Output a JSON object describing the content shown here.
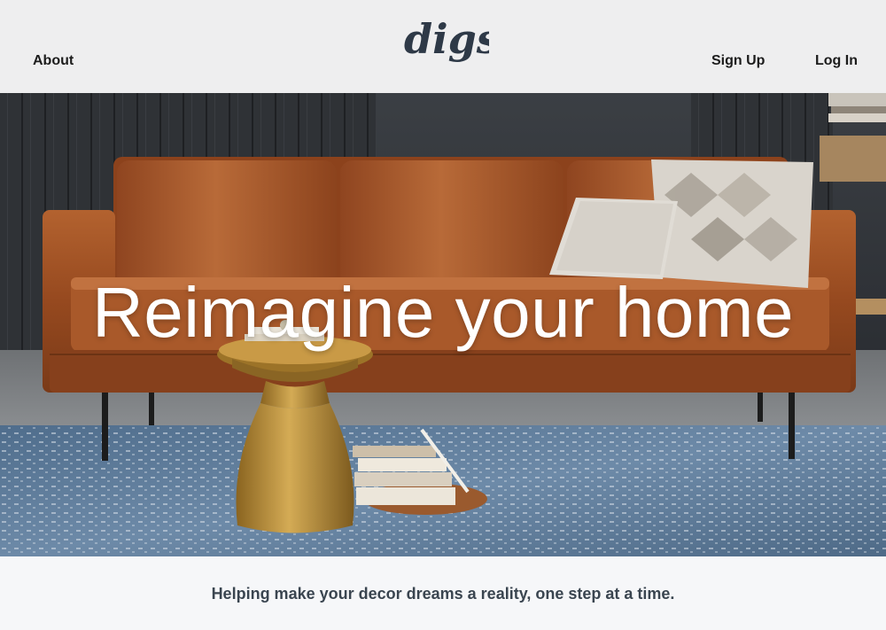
{
  "header": {
    "logo_text": "digs",
    "nav_left": {
      "about_label": "About"
    },
    "nav_right": {
      "signup_label": "Sign Up",
      "login_label": "Log In"
    },
    "background": "#eeeeef"
  },
  "hero": {
    "headline": "Reimagine your home",
    "image_subject": "living room with tan leather sofa, pillows, brass side table, books and blue patterned rug"
  },
  "tagline": {
    "text": "Helping make your decor dreams a reality, one step at a time."
  },
  "colors": {
    "logo": "#2e3947",
    "nav_text": "#1c1c1c",
    "headline": "#ffffff",
    "tagline": "#3a4550",
    "sofa_leather": "#9a4f25",
    "rug": "#5b7897",
    "brass": "#b58a36"
  }
}
